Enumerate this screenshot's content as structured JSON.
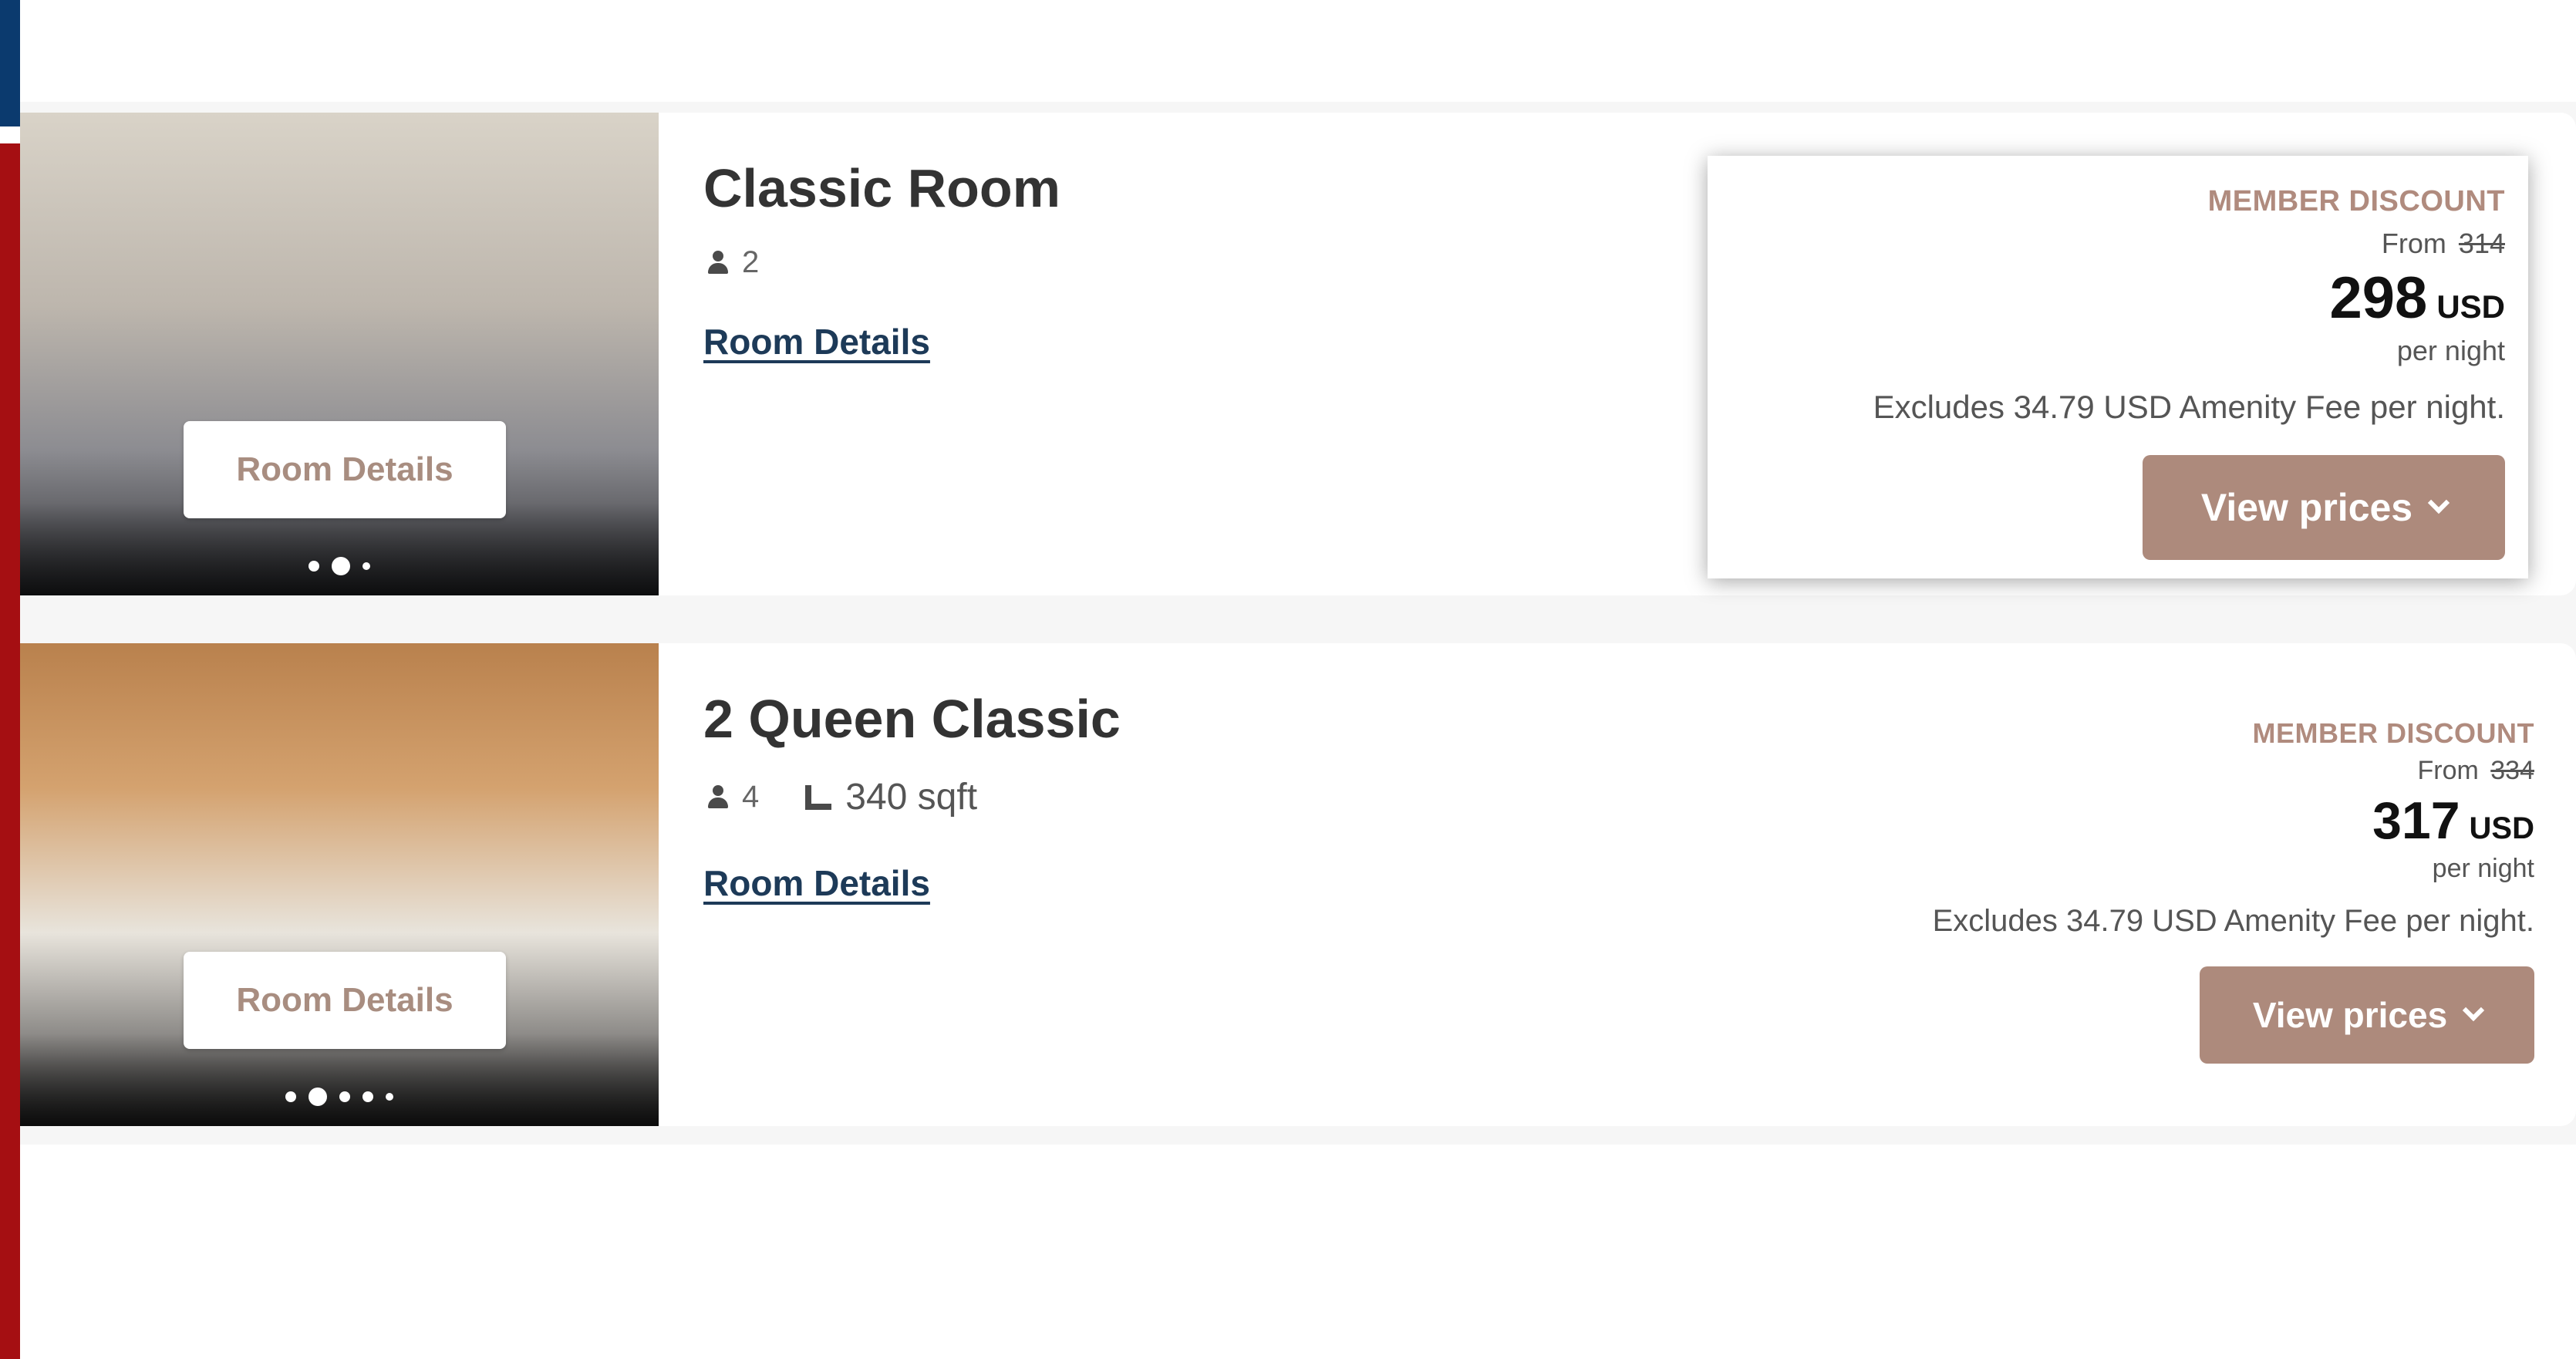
{
  "rooms": [
    {
      "title": "Classic Room",
      "guests": "2",
      "details_link": "Room Details",
      "photo_button": "Room Details",
      "member_discount": "MEMBER DISCOUNT",
      "from_label": "From",
      "original_price": "314",
      "price": "298",
      "currency": "USD",
      "per_night": "per night",
      "fee_note": "Excludes 34.79 USD Amenity Fee per night.",
      "view_prices": "View prices",
      "photo_dots": 3,
      "photo_active_dot": 2
    },
    {
      "title": "2 Queen Classic",
      "guests": "4",
      "size": "340 sqft",
      "details_link": "Room Details",
      "photo_button": "Room Details",
      "member_discount": "MEMBER DISCOUNT",
      "from_label": "From",
      "original_price": "334",
      "price": "317",
      "currency": "USD",
      "per_night": "per night",
      "fee_note": "Excludes 34.79 USD Amenity Fee per night.",
      "view_prices": "View prices",
      "photo_dots": 5,
      "photo_active_dot": 2
    }
  ],
  "icons": {
    "guests": "person-icon",
    "size": "floor-area-icon",
    "dropdown": "chevron-down-icon"
  },
  "colors": {
    "accent": "#ad8a7c",
    "link": "#1d3a58",
    "brand_red": "#a50f12",
    "brand_blue": "#0b3a6e"
  }
}
